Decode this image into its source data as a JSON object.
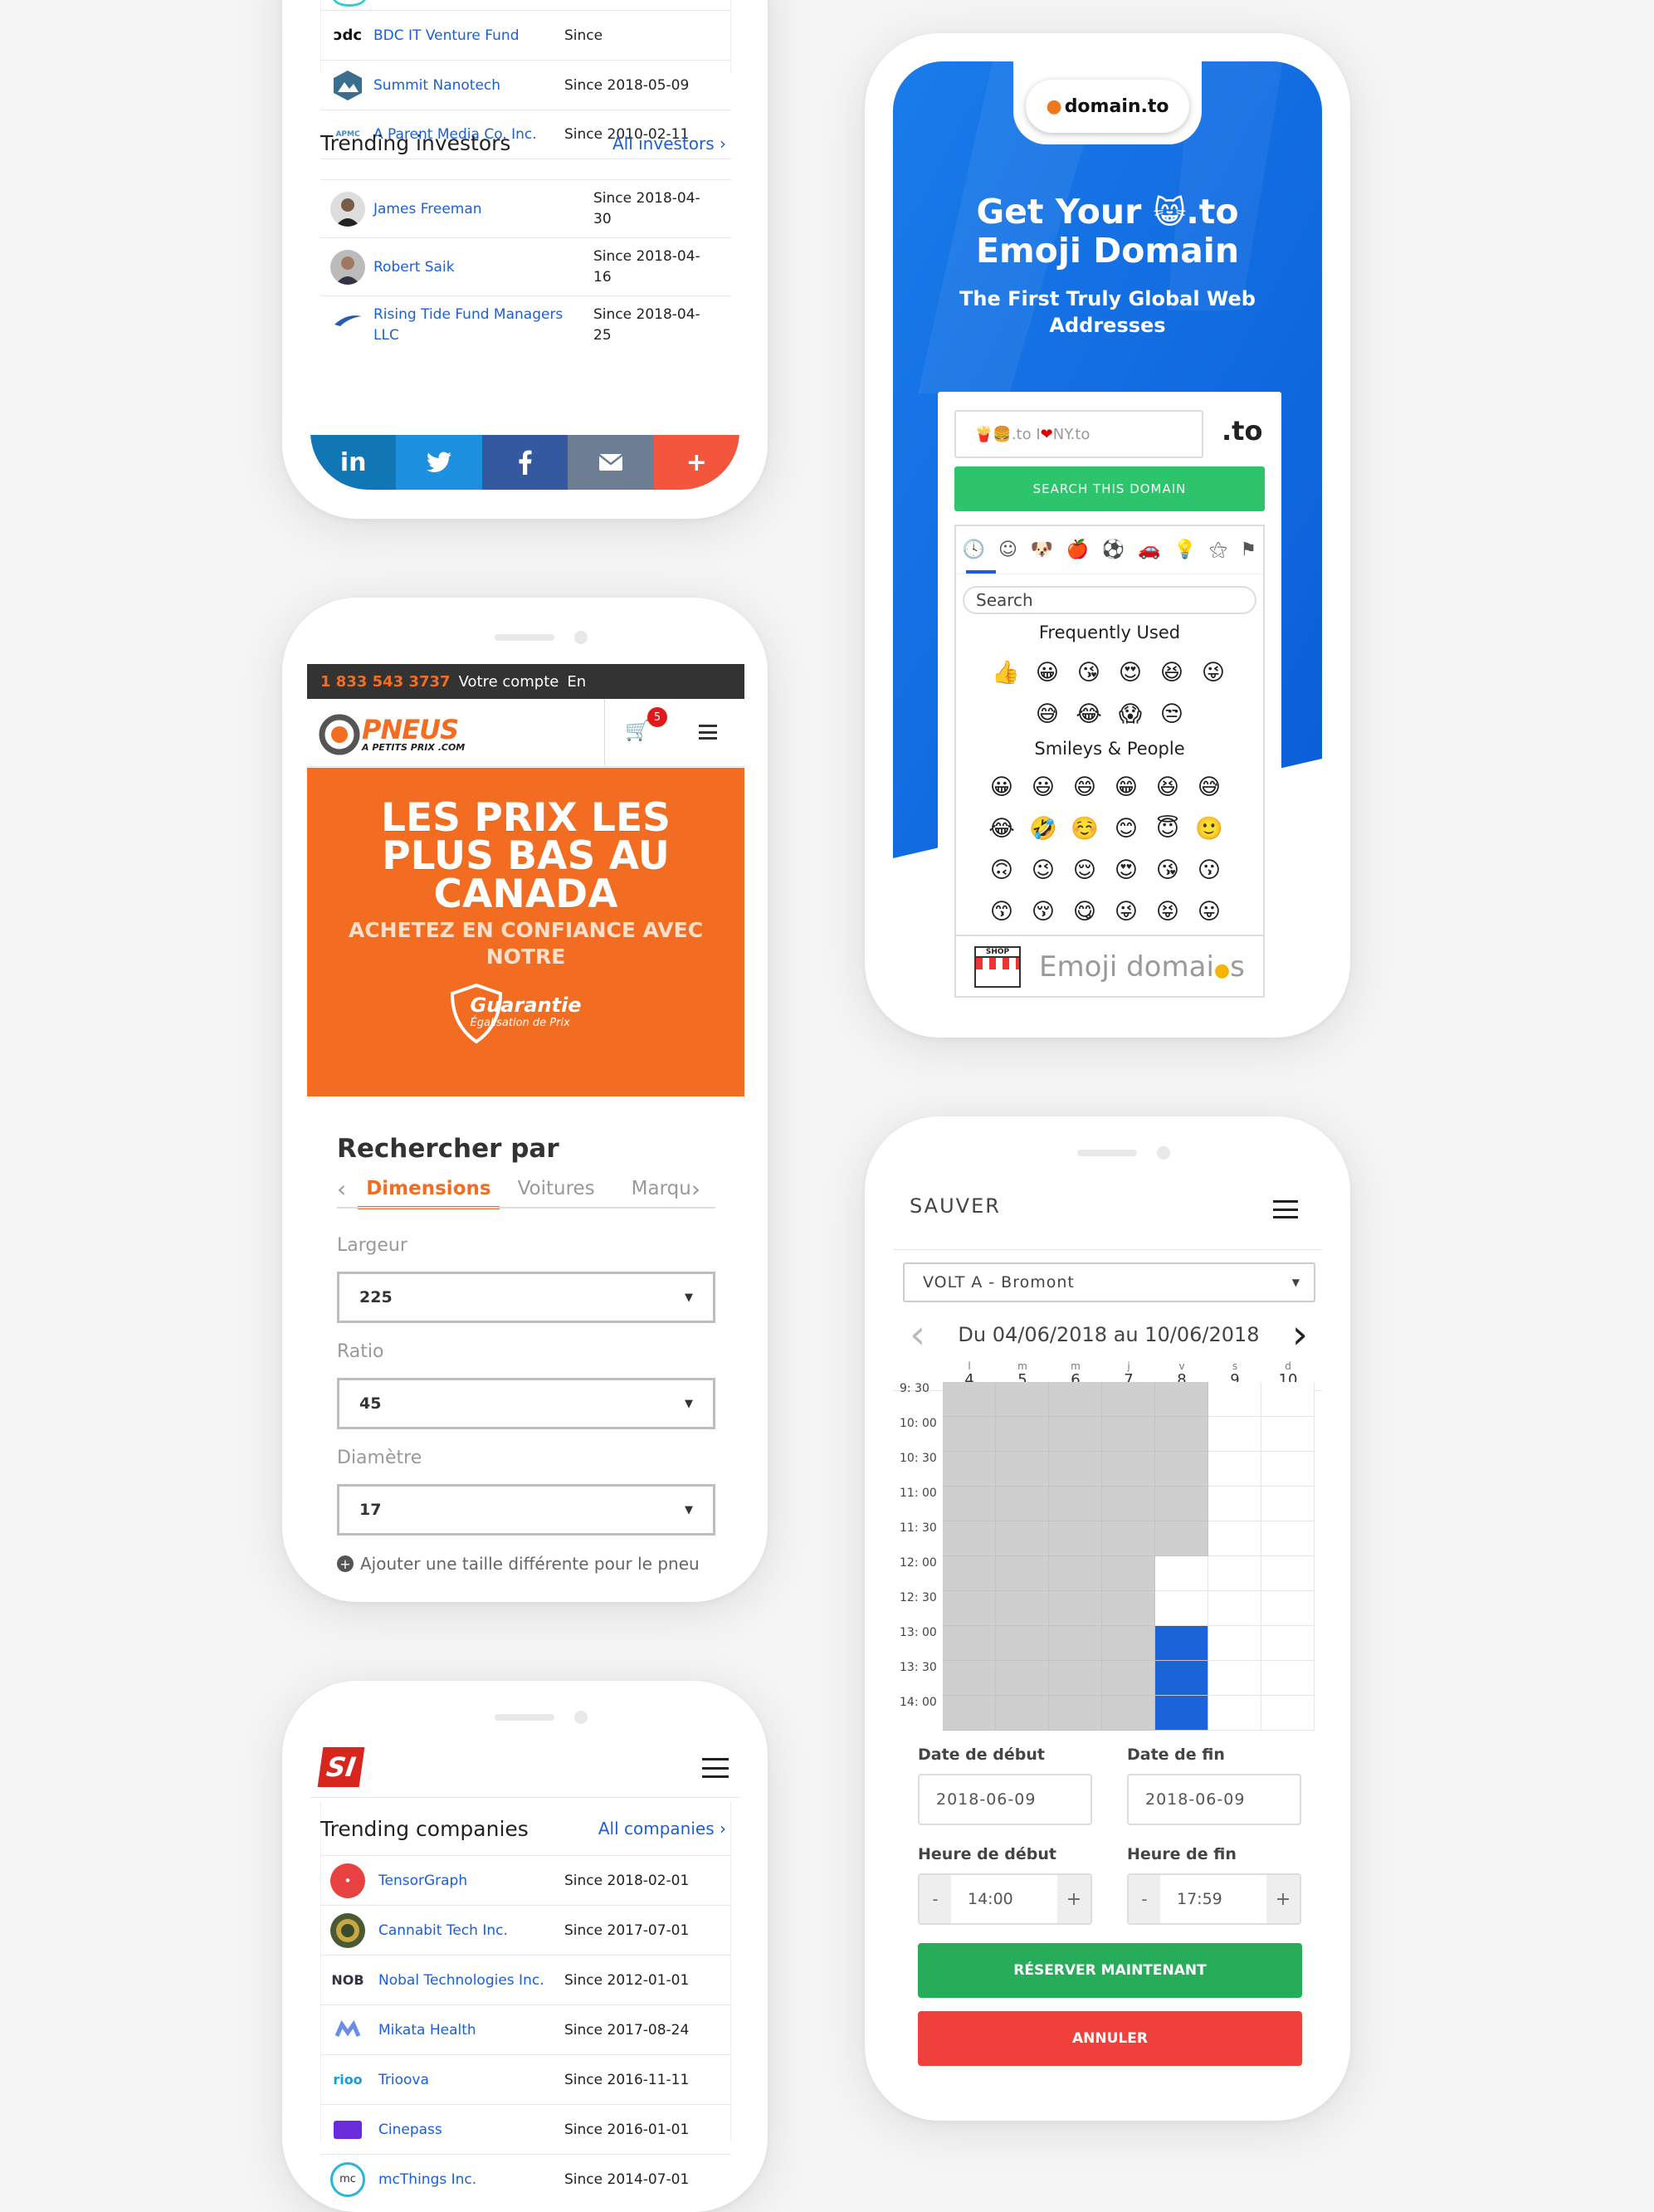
{
  "colors": {
    "link": "#1b5fd8",
    "orange": "#f26d21",
    "green": "#2dbe60",
    "red": "#f0463c",
    "blue_booked": "#1a64d8",
    "grey_booked": "#cfcfcf"
  },
  "investors_phone": {
    "companies": [
      {
        "name": "BDC IT Venture Fund",
        "since": "Since",
        "logo": "bdc-logo"
      },
      {
        "name": "Summit Nanotech",
        "since": "Since 2018-05-09",
        "logo": "mountain-logo"
      },
      {
        "name": "A Parent Media Co. Inc.",
        "since": "Since 2010-02-11",
        "logo": "apmc-logo"
      }
    ],
    "trending_title": "Trending investors",
    "all_investors": "All investors",
    "investors": [
      {
        "name": "James Freeman",
        "since_a": "Since 2018-04-",
        "since_b": "30"
      },
      {
        "name": "Robert Saik",
        "since_a": "Since 2018-04-",
        "since_b": "16"
      },
      {
        "name": "Rising Tide Fund Managers",
        "name_b": "LLC",
        "since_a": "Since 2018-04-",
        "since_b": "25"
      }
    ],
    "share_icons": [
      "linkedin-icon",
      "twitter-icon",
      "facebook-icon",
      "email-icon",
      "plus-icon"
    ],
    "share_labels": {
      "linkedin": "in",
      "plus": "+"
    }
  },
  "emoji_phone": {
    "brand": "domain.to",
    "headline_a": "Get Your",
    "headline_b": ".to",
    "headline_c": "Emoji Domain",
    "subtitle": "The First Truly Global Web Addresses",
    "input_value": ".to  I",
    "input_value_b": "NY.to",
    "tld": ".to",
    "search_button": "SEARCH THIS DOMAIN",
    "search_placeholder": "Search",
    "frequently_used": "Frequently Used",
    "smileys_people": "Smileys & People",
    "freq_emojis": [
      "👍",
      "😀",
      "😘",
      "😍",
      "😆",
      "😜",
      "😅",
      "😂",
      "😱",
      "😒"
    ],
    "smiley_emojis": [
      "😀",
      "😃",
      "😄",
      "😁",
      "😆",
      "😅",
      "😂",
      "🤣",
      "☺️",
      "😊",
      "😇",
      "🙂",
      "🙃",
      "😉",
      "😌",
      "😍",
      "😘",
      "😗",
      "😙",
      "😚",
      "😋",
      "😜",
      "😝",
      "😛"
    ],
    "category_icons": [
      "clock-icon",
      "smiley-icon",
      "animal-icon",
      "food-icon",
      "sport-icon",
      "car-icon",
      "bulb-icon",
      "symbols-icon",
      "flag-icon"
    ],
    "shop_label": "SHOP",
    "footer_text": "Emoji domai",
    "footer_text_b": "s"
  },
  "tires_phone": {
    "phone": "1 833 543 3737",
    "account": "Votre compte",
    "lang": "En",
    "logo_main": "PNEUS",
    "logo_sub": "A PETITS PRIX .COM",
    "cart_count": "5",
    "hero_a": "LES PRIX LES",
    "hero_b": "PLUS BAS AU",
    "hero_c": "CANADA",
    "hero_d": "ACHETEZ EN CONFIANCE AVEC",
    "hero_e": "NOTRE",
    "badge_a": "Guarantie",
    "badge_b": "Égalisation de Prix",
    "search_title": "Rechercher par",
    "tabs": [
      "Dimensions",
      "Voitures",
      "Marqu"
    ],
    "fields": [
      {
        "label": "Largeur",
        "value": "225"
      },
      {
        "label": "Ratio",
        "value": "45"
      },
      {
        "label": "Diamètre",
        "value": "17"
      }
    ],
    "add_size": "Ajouter une taille différente pour le pneu"
  },
  "companies_phone": {
    "logo": "SI",
    "title": "Trending companies",
    "all_companies": "All companies",
    "rows": [
      {
        "name": "TensorGraph",
        "since": "Since 2018-02-01",
        "logo": "tensorgraph-logo"
      },
      {
        "name": "Cannabit Tech Inc.",
        "since": "Since 2017-07-01",
        "logo": "cannabit-logo"
      },
      {
        "name": "Nobal Technologies Inc.",
        "since": "Since 2012-01-01",
        "logo": "nobal-logo",
        "logo_text": "NOB"
      },
      {
        "name": "Mikata Health",
        "since": "Since 2017-08-24",
        "logo": "mikata-logo"
      },
      {
        "name": "Trioova",
        "since": "Since 2016-11-11",
        "logo": "trioova-logo",
        "logo_text": "rioo"
      },
      {
        "name": "Cinepass",
        "since": "Since 2016-01-01",
        "logo": "cinepass-logo"
      },
      {
        "name": "mcThings Inc.",
        "since": "Since 2014-07-01",
        "logo": "mcthings-logo",
        "logo_text": "mc"
      }
    ]
  },
  "booking_phone": {
    "brand": "SAUVER",
    "location": "VOLT A - Bromont",
    "week": "Du 04/06/2018 au 10/06/2018",
    "days": [
      {
        "l": "l",
        "n": "4"
      },
      {
        "l": "m",
        "n": "5"
      },
      {
        "l": "m",
        "n": "6"
      },
      {
        "l": "j",
        "n": "7"
      },
      {
        "l": "v",
        "n": "8"
      },
      {
        "l": "s",
        "n": "9"
      },
      {
        "l": "d",
        "n": "10"
      }
    ],
    "times": [
      "9: 30",
      "10: 00",
      "10: 30",
      "11: 00",
      "11: 30",
      "12: 00",
      "12: 30",
      "13: 00",
      "13: 30",
      "14: 00"
    ],
    "start_date_label": "Date de début",
    "end_date_label": "Date de fin",
    "start_date": "2018-06-09",
    "end_date": "2018-06-09",
    "start_time_label": "Heure de début",
    "end_time_label": "Heure de fin",
    "start_time": "14:00",
    "end_time": "17:59",
    "minus": "-",
    "plus": "+",
    "reserve": "RÉSERVER MAINTENANT",
    "cancel": "ANNULER"
  }
}
